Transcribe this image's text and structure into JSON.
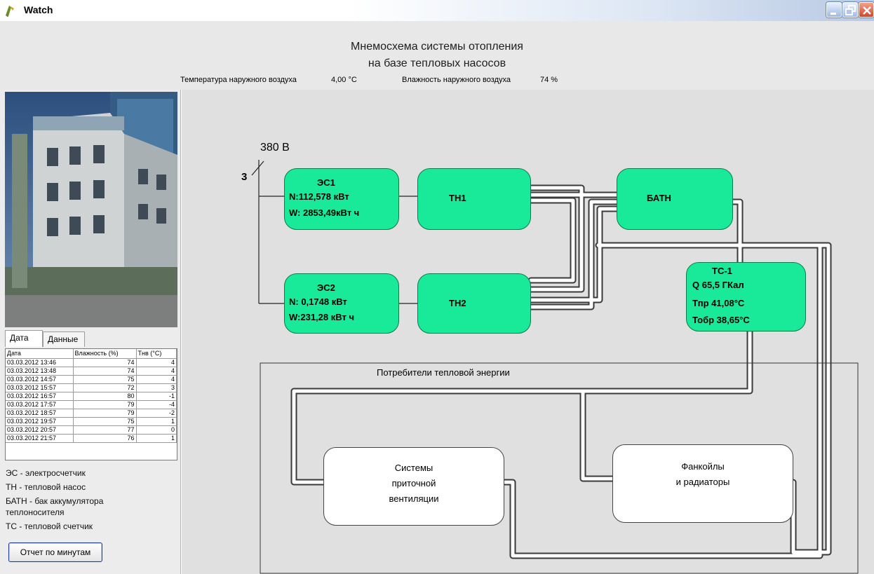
{
  "window": {
    "title": "Watch"
  },
  "header": {
    "title_line1": "Мнемосхема системы отопления",
    "title_line2": "на базе тепловых насосов",
    "outdoor_temp_label": "Температура наружного воздуха",
    "outdoor_temp_value": "4,00 °С",
    "outdoor_humidity_label": "Влажность наружного воздуха",
    "outdoor_humidity_value": "74 %"
  },
  "left": {
    "tabs": [
      "Дата",
      "Данные"
    ],
    "table": {
      "columns": [
        "Дата",
        "Влажность (%)",
        "Тнв (°С)"
      ],
      "rows": [
        [
          "03.03.2012 13:46",
          "74",
          "4"
        ],
        [
          "03.03.2012 13:48",
          "74",
          "4"
        ],
        [
          "03.03.2012 14:57",
          "75",
          "4"
        ],
        [
          "03.03.2012 15:57",
          "72",
          "3"
        ],
        [
          "03.03.2012 16:57",
          "80",
          "-1"
        ],
        [
          "03.03.2012 17:57",
          "79",
          "-4"
        ],
        [
          "03.03.2012 18:57",
          "79",
          "-2"
        ],
        [
          "03.03.2012 19:57",
          "75",
          "1"
        ],
        [
          "03.03.2012 20:57",
          "77",
          "0"
        ],
        [
          "03.03.2012 21:57",
          "76",
          "1"
        ]
      ]
    },
    "legend": {
      "es": "ЭС - электросчетчик",
      "th": "ТН - тепловой насос",
      "bath_line1": "БАТН - бак аккумулятора",
      "bath_line2": "теплоносителя",
      "ts": "ТС - тепловой счетчик"
    },
    "report_button": "Отчет по минутам"
  },
  "diagram": {
    "voltage": "380 В",
    "phases": "3",
    "es1": {
      "name": "ЭС1",
      "n": "N:112,578 кВт",
      "w": "W: 2853,49кВт ч"
    },
    "es2": {
      "name": "ЭС2",
      "n": "N: 0,1748 кВт",
      "w": "W:231,28 кВт ч"
    },
    "th1": "ТН1",
    "th2": "ТН2",
    "bath": "БАТН",
    "ts1": {
      "name": "ТС-1",
      "q": "Q 65,5 ГКал",
      "tpr": "Тпр 41,08°С",
      "tobr": "Тобр 38,65°С"
    },
    "consumers_title": "Потребители тепловой энергии",
    "ventilation": [
      "Системы",
      "приточной",
      "вентиляции"
    ],
    "fancoils": [
      "Фанкойлы",
      "и радиаторы"
    ]
  },
  "colors": {
    "node_green": "#19ea9a",
    "background_gray": "#e0e0e0",
    "close_red": "#d0452a"
  },
  "icons": [
    "app-icon",
    "minimize-icon",
    "restore-icon",
    "close-icon"
  ]
}
